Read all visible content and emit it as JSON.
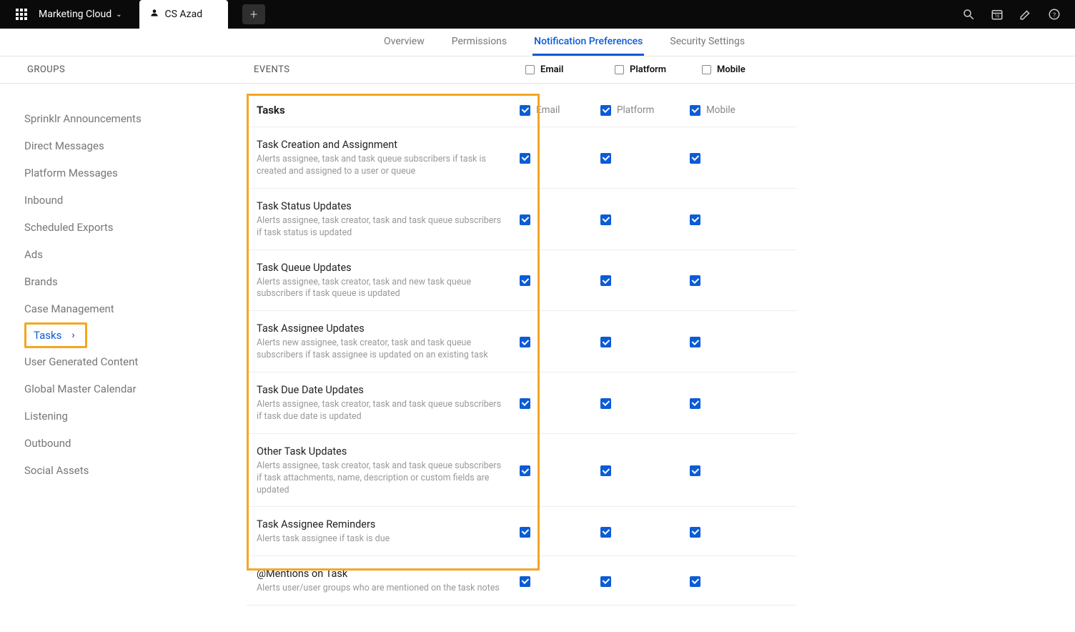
{
  "topbar": {
    "dropdown_label": "Marketing Cloud",
    "active_tab": "CS Azad"
  },
  "subnav": {
    "items": [
      "Overview",
      "Permissions",
      "Notification Preferences",
      "Security Settings"
    ],
    "active_index": 2
  },
  "col_headers": {
    "groups": "GROUPS",
    "events": "EVENTS",
    "email": "Email",
    "platform": "Platform",
    "mobile": "Mobile"
  },
  "sidebar": {
    "items": [
      "Sprinklr Announcements",
      "Direct Messages",
      "Platform Messages",
      "Inbound",
      "Scheduled Exports",
      "Ads",
      "Brands",
      "Case Management",
      "Tasks",
      "User Generated Content",
      "Global Master Calendar",
      "Listening",
      "Outbound",
      "Social Assets"
    ],
    "active_index": 8
  },
  "section": {
    "title": "Tasks",
    "channels": {
      "email": "Email",
      "platform": "Platform",
      "mobile": "Mobile"
    }
  },
  "events": [
    {
      "title": "Task Creation and Assignment",
      "desc": "Alerts assignee, task and task queue subscribers if task is created and assigned to a user or queue"
    },
    {
      "title": "Task Status Updates",
      "desc": "Alerts assignee, task creator, task and task queue subscribers if task status is updated"
    },
    {
      "title": "Task Queue Updates",
      "desc": "Alerts assignee, task creator, task and new task queue subscribers if task queue is updated"
    },
    {
      "title": "Task Assignee Updates",
      "desc": "Alerts new assignee, task creator, task and task queue subscribers if task assignee is updated on an existing task"
    },
    {
      "title": "Task Due Date Updates",
      "desc": "Alerts assignee, task creator, task and task queue subscribers if task due date is updated"
    },
    {
      "title": "Other Task Updates",
      "desc": "Alerts assignee, task creator, task and task queue subscribers if task attachments, name, description or custom fields are updated"
    },
    {
      "title": "Task Assignee Reminders",
      "desc": "Alerts task assignee if task is due"
    },
    {
      "title": "@Mentions on Task",
      "desc": "Alerts user/user groups who are mentioned on the task notes"
    }
  ]
}
